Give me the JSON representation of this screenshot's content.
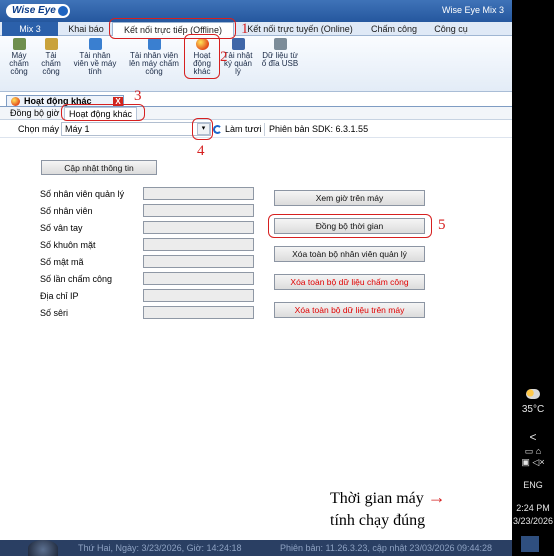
{
  "app": {
    "logo": "Wise Eye",
    "title": "Wise Eye Mix 3"
  },
  "tabs": [
    {
      "label": "Mix 3"
    },
    {
      "label": "Khai báo"
    },
    {
      "label": "Kết nối trực tiếp (Offline)"
    },
    {
      "label": "Kết nối trực tuyến (Online)"
    },
    {
      "label": "Chấm công"
    },
    {
      "label": "Công cụ"
    }
  ],
  "ribbon": [
    {
      "line1": "Máy",
      "line2": "chấm",
      "line3": "công",
      "icon": "clock-machine-icon"
    },
    {
      "line1": "Tải",
      "line2": "chấm",
      "line3": "công",
      "icon": "download-icon"
    },
    {
      "line1": "Tải nhân",
      "line2": "viên về máy",
      "line3": "tính",
      "icon": "user-download-icon"
    },
    {
      "line1": "Tải nhân viên",
      "line2": "lên máy chấm",
      "line3": "công",
      "icon": "user-upload-icon"
    },
    {
      "line1": "Hoạt",
      "line2": "động",
      "line3": "khác",
      "icon": "activity-icon"
    },
    {
      "line1": "Tải nhật",
      "line2": "ký quản",
      "line3": "lý",
      "icon": "log-icon"
    },
    {
      "line1": "Dữ liệu từ",
      "line2": "ổ đĩa USB",
      "line3": "",
      "icon": "usb-icon"
    }
  ],
  "doc_tab": {
    "label": "Hoạt động khác",
    "close": "X"
  },
  "sub_tabs": [
    {
      "label": "Đồng bộ giờ"
    },
    {
      "label": "Hoạt động khác"
    }
  ],
  "toolbar": {
    "choose_label": "Chọn máy",
    "machine_value": "Máy 1",
    "refresh_label": "Làm tươi",
    "sdk_label": "Phiên bản SDK: 6.3.1.55"
  },
  "update_button": "Cập nhật thông tin",
  "fields": [
    "Số nhân viên quản lý",
    "Số nhân viên",
    "Số vân tay",
    "Số khuôn mặt",
    "Số mật mã",
    "Số lần chấm công",
    "Địa chỉ IP",
    "Số sêri"
  ],
  "actions": [
    {
      "label": "Xem giờ trên máy",
      "red": false
    },
    {
      "label": "Đồng bộ thời gian",
      "red": false
    },
    {
      "label": "Xóa toàn bộ nhân viên quản lý",
      "red": false
    },
    {
      "label": "Xóa toàn bộ dữ liệu chấm công",
      "red": true
    },
    {
      "label": "Xóa toàn bộ dữ liệu trên máy",
      "red": true
    }
  ],
  "annotations": {
    "n1": "1",
    "n2": "2",
    "n3": "3",
    "n4": "4",
    "n5": "5"
  },
  "note": {
    "line1": "Thời gian máy",
    "line2": "tính chạy đúng",
    "arrow": "→"
  },
  "status": {
    "left": "Thứ Hai, Ngày: 3/23/2026, Giờ: 14:24:18",
    "right": "Phiên bản: 11.26.3.23, cập nhật 23/03/2026 09:44:28"
  },
  "taskbar": {
    "temp": "35°C",
    "chevron": "<",
    "lang": "ENG",
    "time": "2:24 PM",
    "date": "3/23/2026"
  },
  "colors": {
    "accent": "#2b60aa",
    "annotation": "#d62020",
    "danger": "#e00000"
  }
}
